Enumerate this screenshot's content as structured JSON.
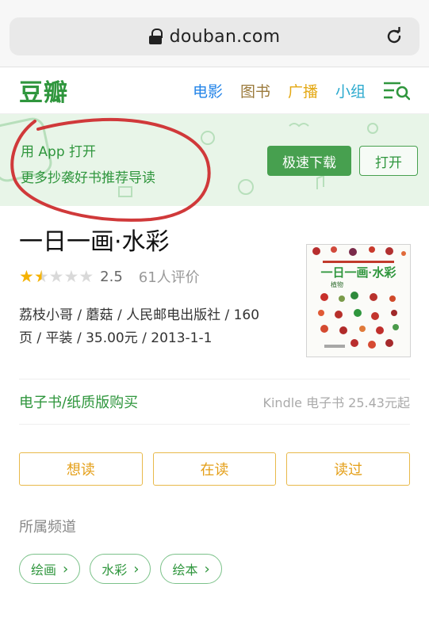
{
  "browser": {
    "url": "douban.com"
  },
  "nav": {
    "logo": "豆瓣",
    "items": [
      {
        "label": "电影"
      },
      {
        "label": "图书"
      },
      {
        "label": "广播"
      },
      {
        "label": "小组"
      }
    ]
  },
  "banner": {
    "line1": "用 App 打开",
    "line2": "更多抄袭好书推荐导读",
    "download": "极速下载",
    "open": "打开"
  },
  "book": {
    "title": "一日一画·水彩",
    "rating": "2.5",
    "stars": 1.5,
    "ratings_count": "61人评价",
    "meta_line1": "荔枝小哥 / 蘑菇 / 人民邮电出版社 / 160",
    "meta_line2": "页 / 平装 / 35.00元 / 2013-1-1",
    "cover": {
      "title": "一日一画·水彩",
      "subtitle": "植物"
    }
  },
  "buy": {
    "link": "电子书/纸质版购买",
    "price": "Kindle 电子书 25.43元起"
  },
  "actions": {
    "want": "想读",
    "reading": "在读",
    "read": "读过"
  },
  "channels": {
    "title": "所属频道",
    "tags": [
      {
        "label": "绘画"
      },
      {
        "label": "水彩"
      },
      {
        "label": "绘本"
      }
    ]
  },
  "colors": {
    "brand_green": "#2f963d",
    "accent_orange": "#e49f18",
    "annotation_red": "#d0393a"
  }
}
